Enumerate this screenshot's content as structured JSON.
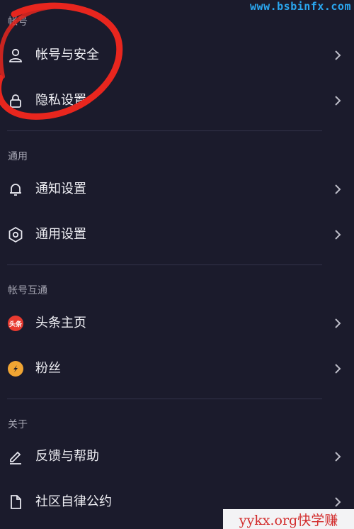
{
  "sections": [
    {
      "title": "帐号",
      "items": [
        {
          "label": "帐号与安全",
          "icon": "user-icon"
        },
        {
          "label": "隐私设置",
          "icon": "lock-icon"
        }
      ]
    },
    {
      "title": "通用",
      "items": [
        {
          "label": "通知设置",
          "icon": "bell-icon"
        },
        {
          "label": "通用设置",
          "icon": "gear-icon"
        }
      ]
    },
    {
      "title": "帐号互通",
      "items": [
        {
          "label": "头条主页",
          "icon": "toutiao-icon",
          "badge": "头条"
        },
        {
          "label": "粉丝",
          "icon": "fans-icon"
        }
      ]
    },
    {
      "title": "关于",
      "items": [
        {
          "label": "反馈与帮助",
          "icon": "edit-icon"
        },
        {
          "label": "社区自律公约",
          "icon": "document-icon"
        }
      ]
    }
  ],
  "watermarks": {
    "top": "www.bsbinfx.com",
    "bottom": "yykx.org快学赚"
  },
  "colors": {
    "background": "#1b1b2c",
    "scribble": "#e8261e",
    "toutiao": "#e83a30",
    "fans": "#f0a533"
  }
}
